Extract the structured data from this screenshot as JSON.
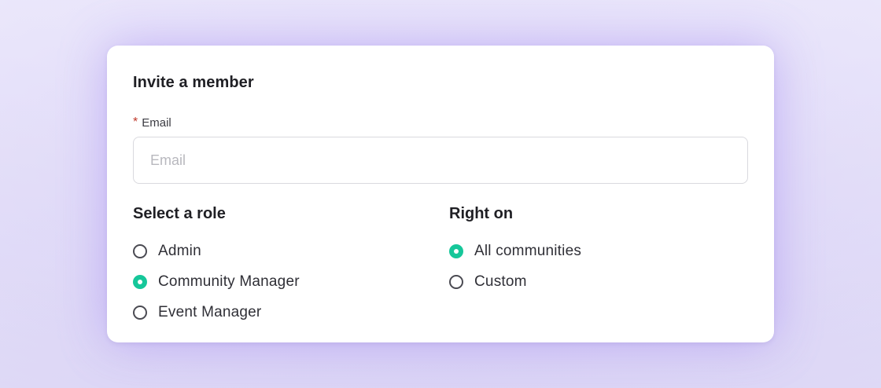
{
  "dialog": {
    "title": "Invite a member"
  },
  "email": {
    "required_mark": "*",
    "label": "Email",
    "value": "",
    "placeholder": "Email"
  },
  "role": {
    "title": "Select a role",
    "options": [
      {
        "label": "Admin",
        "selected": false
      },
      {
        "label": "Community Manager",
        "selected": true
      },
      {
        "label": "Event Manager",
        "selected": false
      }
    ]
  },
  "rights": {
    "title": "Right on",
    "options": [
      {
        "label": "All communities",
        "selected": true
      },
      {
        "label": "Custom",
        "selected": false
      }
    ]
  },
  "colors": {
    "accent": "#16c79a",
    "required": "#c0392b",
    "background": "#ddd6f8"
  }
}
